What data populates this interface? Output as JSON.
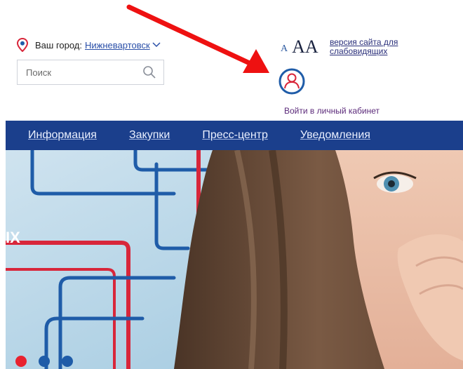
{
  "header": {
    "city_label": "Ваш город:",
    "city_value": "Нижневартовск",
    "search_placeholder": "Поиск",
    "font_small": "A",
    "font_medium": "A",
    "font_large": "A",
    "low_vision_link": "версия сайта для слабовидящих",
    "login_link": "Войти в личный кабинет"
  },
  "nav": {
    "items": [
      {
        "label": "Информация"
      },
      {
        "label": "Закупки"
      },
      {
        "label": "Пресс-центр"
      },
      {
        "label": "Уведомления"
      }
    ]
  },
  "banner": {
    "overlay_text": "IX",
    "slides": {
      "count": 3,
      "active_index": 0
    }
  },
  "colors": {
    "nav_bg": "#1b3f8c",
    "accent_red": "#d8263a",
    "dot_blue": "#1f5ca8",
    "arrow": "#ee1111"
  }
}
